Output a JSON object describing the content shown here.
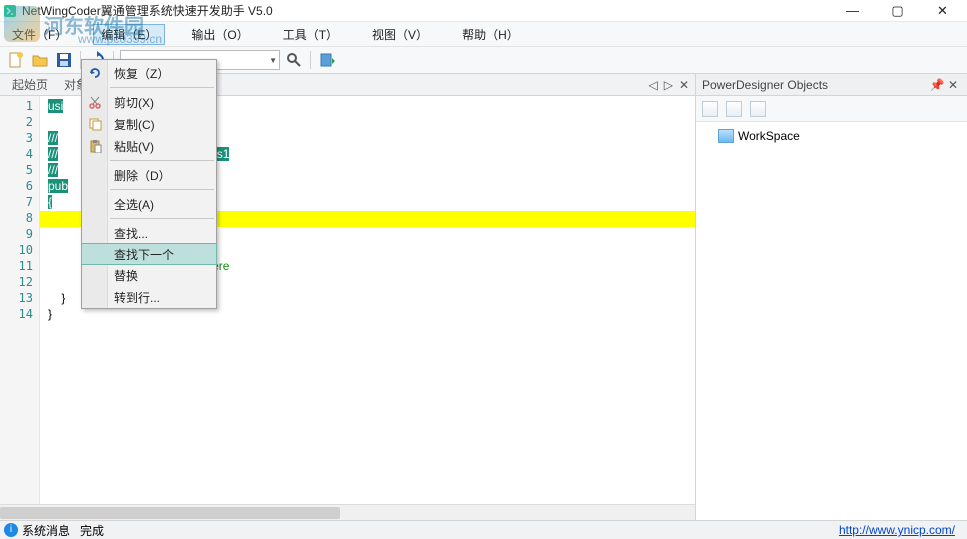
{
  "watermark": {
    "text": "河东软件园",
    "url": "www.pc0359.cn"
  },
  "title": "NetWingCoder翼通管理系统快速开发助手 V5.0",
  "menu": {
    "file": "文件（F）",
    "edit": "编辑（E）",
    "output": "输出（O）",
    "tools": "工具（T）",
    "view": "视图（V）",
    "help": "帮助（H）"
  },
  "context": {
    "redo": "恢复（Z）",
    "cut": "剪切(X)",
    "copy": "复制(C)",
    "paste": "粘贴(V)",
    "delete": "删除（D）",
    "selectAll": "全选(A)",
    "find": "查找...",
    "findNext": "查找下一个",
    "replace": "替换",
    "goto": "转到行..."
  },
  "tabs": {
    "start": "起始页",
    "obj": "对象"
  },
  "code": {
    "l1": "usi",
    "l3": "///",
    "l4a": "///",
    "l4b": "ion for Class1",
    "l5": "///",
    "l6": "pub",
    "l7": "{",
    "l9_cls": "()",
    "l11": "constructor logic here",
    "l13": "}",
    "l14": "}"
  },
  "panel": {
    "title": "PowerDesigner Objects",
    "workspace": "WorkSpace"
  },
  "status": {
    "sysmsg": "系统消息",
    "done": "完成",
    "link": "http://www.ynicp.com/"
  }
}
